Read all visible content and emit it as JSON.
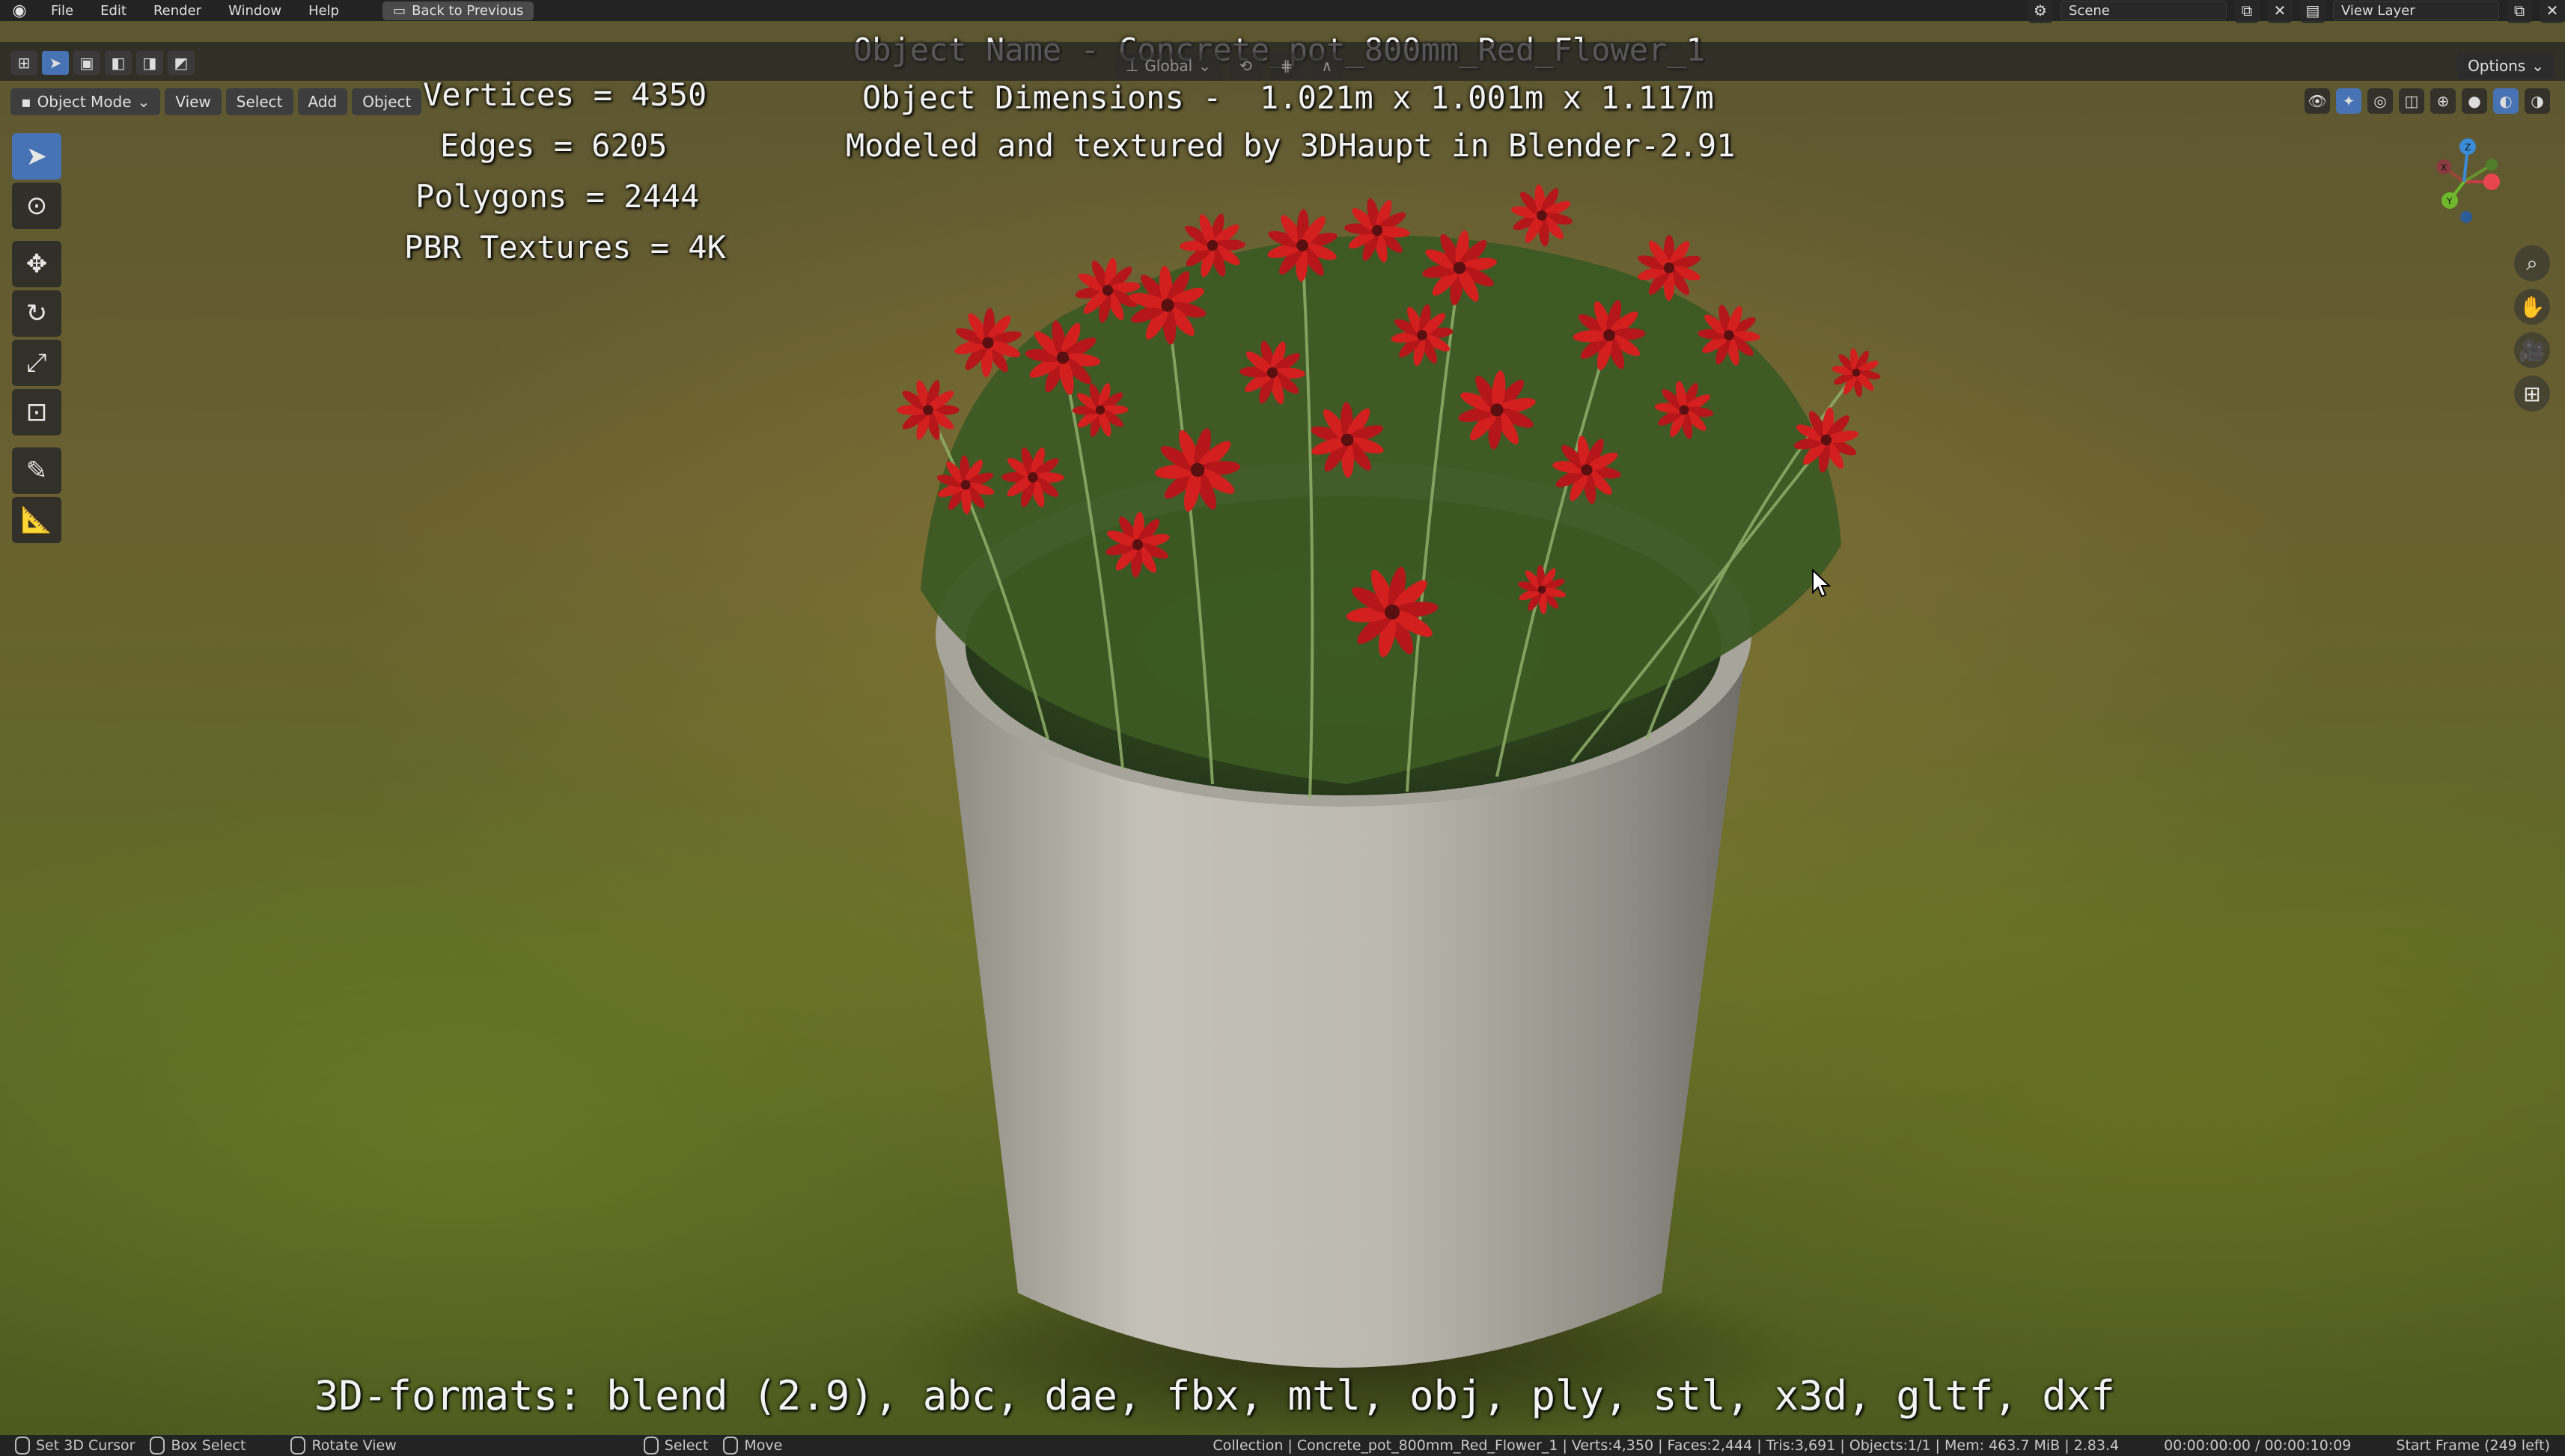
{
  "topbar": {
    "menus": [
      "File",
      "Edit",
      "Render",
      "Window",
      "Help"
    ],
    "back_button": "Back to Previous",
    "scene_label": "Scene",
    "view_layer_label": "View Layer"
  },
  "header": {
    "mode": "Object Mode",
    "menus": [
      "View",
      "Select",
      "Add",
      "Object"
    ],
    "transform_orientation": "Global",
    "options_label": "Options"
  },
  "overlay": {
    "object_name": "Object Name - Concrete_pot_800mm_Red_Flower_1",
    "object_dimensions": "Object Dimensions -  1.021m x 1.001m x 1.117m",
    "credit": "Modeled and textured by 3DHaupt in Blender-2.91",
    "vertices": "Vertices = 4350",
    "edges": "Edges = 6205",
    "polygons": "Polygons = 2444",
    "textures": "PBR Textures = 4K",
    "formats": "3D-formats: blend (2.9), abc, dae, fbx, mtl, obj, ply, stl, x3d, gltf, dxf"
  },
  "toolbar": {
    "tools": [
      "select-box",
      "cursor",
      "move",
      "rotate",
      "scale",
      "transform",
      "annotate",
      "measure"
    ],
    "active": "select-box"
  },
  "gizmo": {
    "axes": [
      "X",
      "Y",
      "Z"
    ],
    "colors": {
      "x": "#e8464f",
      "y": "#6fb82d",
      "z": "#3a8bd8"
    }
  },
  "statusbar": {
    "set_cursor": "Set 3D Cursor",
    "box_select": "Box Select",
    "rotate_view": "Rotate View",
    "select": "Select",
    "move": "Move",
    "stats": "Collection | Concrete_pot_800mm_Red_Flower_1 | Verts:4,350 | Faces:2,444 | Tris:3,691 | Objects:1/1 | Mem: 463.7 MiB | 2.83.4",
    "time": "00:00:00:00 / 00:00:10:09",
    "start_frame": "Start Frame (249 left)"
  },
  "colors": {
    "accent": "#4772b3",
    "flower_red": "#d41f1f",
    "pot_gray": "#b8b5ac"
  }
}
